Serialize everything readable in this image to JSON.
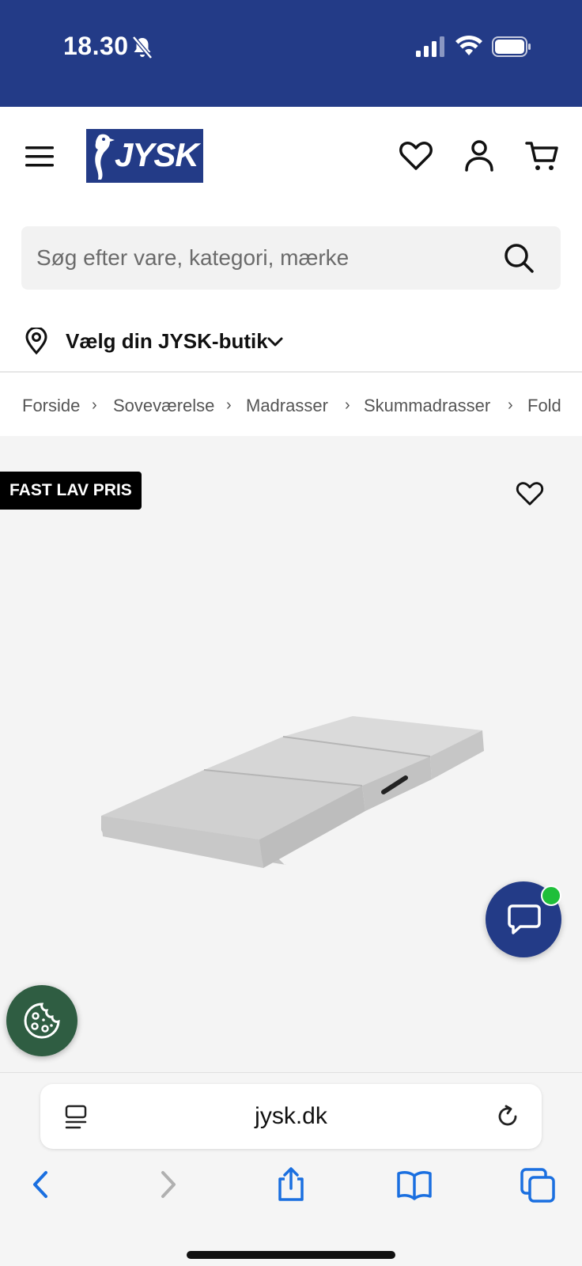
{
  "status_bar": {
    "time": "18.30",
    "colors": {
      "background": "#233b87"
    }
  },
  "header": {
    "logo_text": "JYSK",
    "menu_icon": "hamburger-icon",
    "wishlist_icon": "heart-icon",
    "account_icon": "user-icon",
    "cart_icon": "cart-icon"
  },
  "search": {
    "placeholder": "Søg efter vare, kategori, mærke"
  },
  "store_selector": {
    "label": "Vælg din JYSK-butik"
  },
  "breadcrumb": {
    "items": [
      "Forside",
      "Soveværelse",
      "Madrasser",
      "Skummadrasser",
      "Fold"
    ]
  },
  "product": {
    "badge": "FAST LAV PRIS",
    "colors": {
      "brand": "#233b87",
      "chat_online": "#1fbf3a",
      "cookie_button": "#2f5d42"
    }
  },
  "browser": {
    "url": "jysk.dk",
    "icons": [
      "back-icon",
      "forward-icon",
      "share-icon",
      "bookmarks-icon",
      "tabs-icon"
    ]
  }
}
